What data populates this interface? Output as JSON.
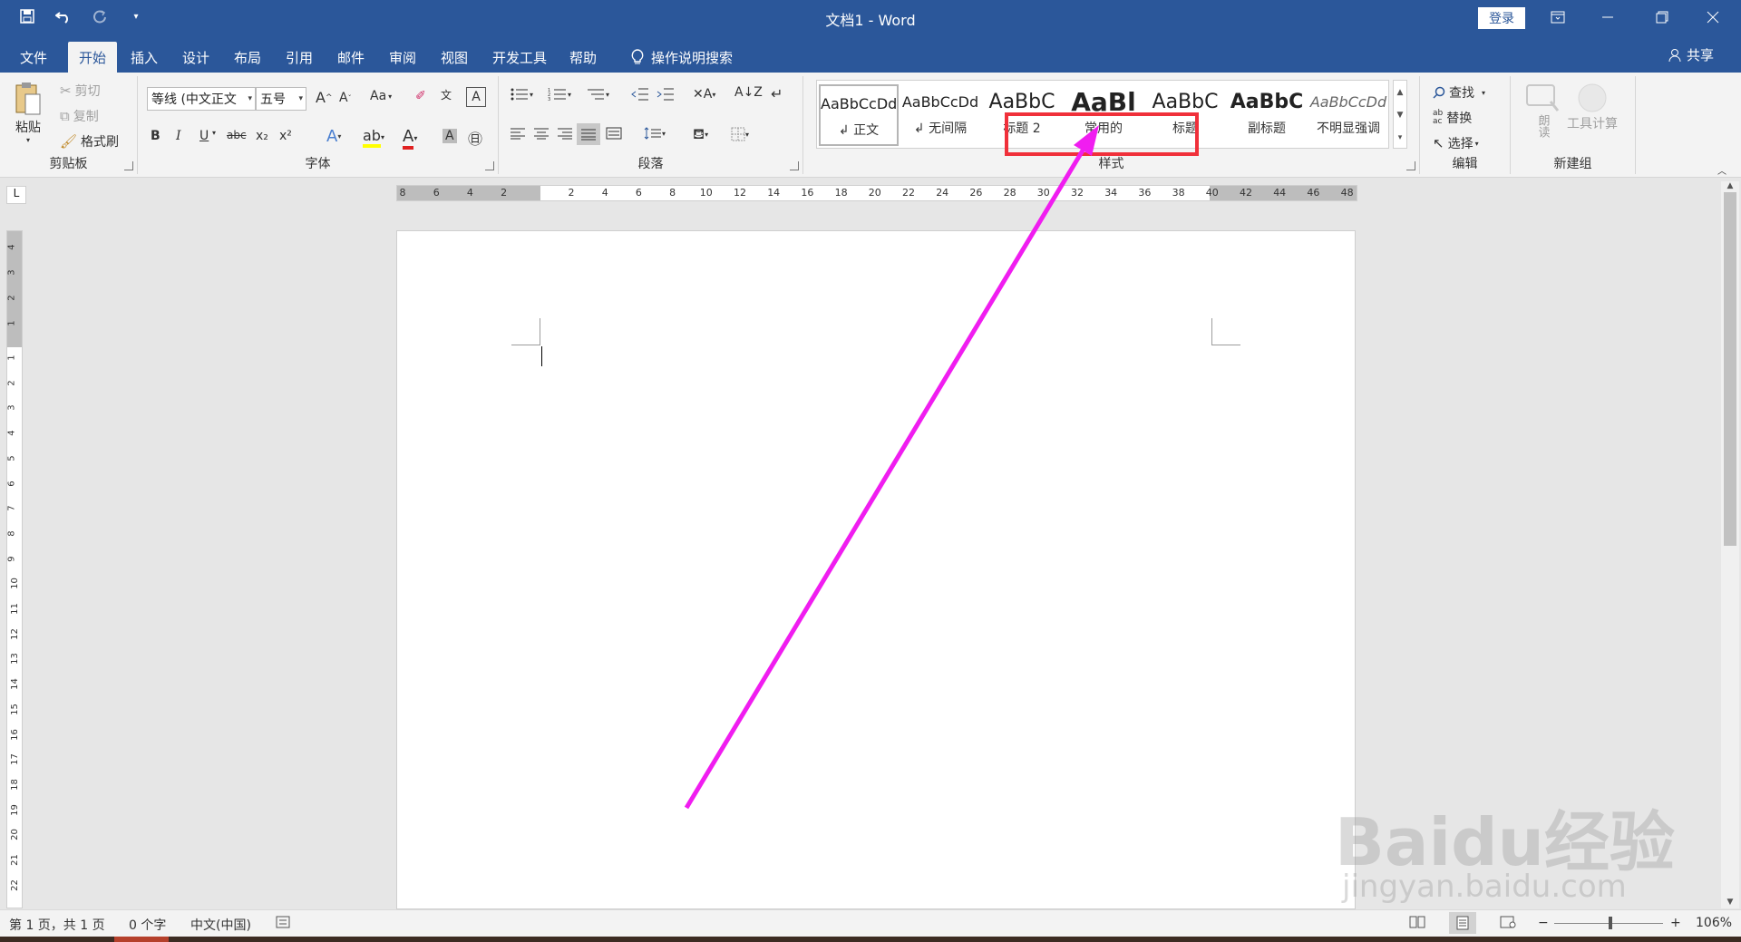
{
  "window": {
    "title": "文档1  -  Word",
    "login_label": "登录",
    "controls": [
      "ribbon-display-icon",
      "minimize-icon",
      "restore-icon",
      "close-icon"
    ]
  },
  "qat": {
    "icons": [
      "save-icon",
      "undo-icon",
      "redo-icon",
      "customize-icon"
    ]
  },
  "tabs": [
    {
      "label": "文件"
    },
    {
      "label": "开始",
      "active": true
    },
    {
      "label": "插入"
    },
    {
      "label": "设计"
    },
    {
      "label": "布局"
    },
    {
      "label": "引用"
    },
    {
      "label": "邮件"
    },
    {
      "label": "审阅"
    },
    {
      "label": "视图"
    },
    {
      "label": "开发工具"
    },
    {
      "label": "帮助"
    },
    {
      "label": "操作说明搜索"
    }
  ],
  "share_label": "共享",
  "clipboard": {
    "group_label": "剪贴板",
    "paste": "粘贴",
    "cut": "剪切",
    "copy": "复制",
    "format_painter": "格式刷"
  },
  "font": {
    "group_label": "字体",
    "font_name": "等线 (中文正文",
    "font_size": "五号",
    "case_label": "Aa",
    "buttons": [
      "B",
      "I",
      "U",
      "abc",
      "x₂",
      "x²"
    ]
  },
  "paragraph": {
    "group_label": "段落"
  },
  "styles": {
    "group_label": "样式",
    "items": [
      {
        "sample": "AaBbCcDd",
        "name": "↲ 正文"
      },
      {
        "sample": "AaBbCcDd",
        "name": "↲ 无间隔"
      },
      {
        "sample": "AaBbC",
        "name": "标题 2"
      },
      {
        "sample": "AaBl",
        "name": "常用的"
      },
      {
        "sample": "AaBbC",
        "name": "标题"
      },
      {
        "sample": "AaBbC",
        "name": "副标题"
      },
      {
        "sample": "AaBbCcDd",
        "name": "不明显强调"
      }
    ]
  },
  "editing": {
    "group_label": "编辑",
    "find": "查找",
    "replace": "替换",
    "select": "选择"
  },
  "new_group": {
    "group_label": "新建组",
    "read_aloud": "朗读",
    "tool_calc": "工具计算"
  },
  "ruler": {
    "h_ticks": [
      "8",
      "6",
      "4",
      "2",
      "",
      "2",
      "4",
      "6",
      "8",
      "10",
      "12",
      "14",
      "16",
      "18",
      "20",
      "22",
      "24",
      "26",
      "28",
      "30",
      "32",
      "34",
      "36",
      "38",
      "40",
      "42",
      "44",
      "46",
      "48"
    ],
    "v_ticks_top": [
      "4",
      "3",
      "2",
      "1"
    ],
    "v_ticks": [
      "1",
      "2",
      "3",
      "4",
      "5",
      "6",
      "7",
      "8",
      "9",
      "10",
      "11",
      "12",
      "13",
      "14",
      "15",
      "16",
      "17",
      "18",
      "19",
      "20",
      "21",
      "22"
    ],
    "tab_selector": "L"
  },
  "status": {
    "page": "第 1 页，共 1 页",
    "words": "0 个字",
    "language": "中文(中国)",
    "zoom": "106%"
  },
  "watermark": {
    "main": "Baidu经验",
    "sub": "jingyan.baidu.com"
  },
  "annotation": {
    "box_color": "#f0303a",
    "arrow_color": "#f01df0"
  },
  "colors": {
    "title_bar": "#2b579a",
    "ribbon": "#f3f3f3"
  }
}
